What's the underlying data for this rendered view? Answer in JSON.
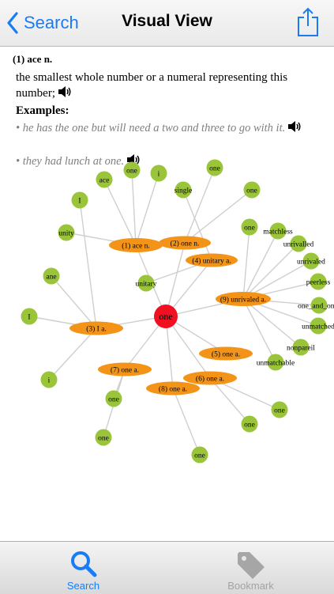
{
  "navbar": {
    "back_label": "Search",
    "title": "Visual View"
  },
  "entry": {
    "head": "(1) ace n.",
    "definition": "the smallest whole number or a numeral representing this number;",
    "examples_label": "Examples:",
    "examples": [
      "• he has the one but will need a two and three to go with it.",
      "• they had lunch at one."
    ]
  },
  "graph": {
    "center": "one",
    "senses": [
      "(1) ace n.",
      "(2) one n.",
      "(4) unitary a.",
      "(9) unrivaled a.",
      "(3) I a.",
      "(5) one a.",
      "(6) one a.",
      "(7) one a.",
      "(8) one a."
    ],
    "words": [
      "ace",
      "one",
      "i",
      "one",
      "single",
      "one",
      "I",
      "unity",
      "unitary",
      "one",
      "matchless",
      "unrivalled",
      "unrivaled",
      "peerless",
      "one_and_only",
      "unmatched",
      "nonpareil",
      "unmatchable",
      "ane",
      "I",
      "i",
      "one",
      "one",
      "one",
      "one",
      "one"
    ]
  },
  "tabs": {
    "search_label": "Search",
    "bookmark_label": "Bookmark"
  },
  "colors": {
    "accent": "#1a7cf5",
    "word_node": "#9ac43a",
    "sense_node": "#f39418",
    "center_node": "#f01020"
  }
}
